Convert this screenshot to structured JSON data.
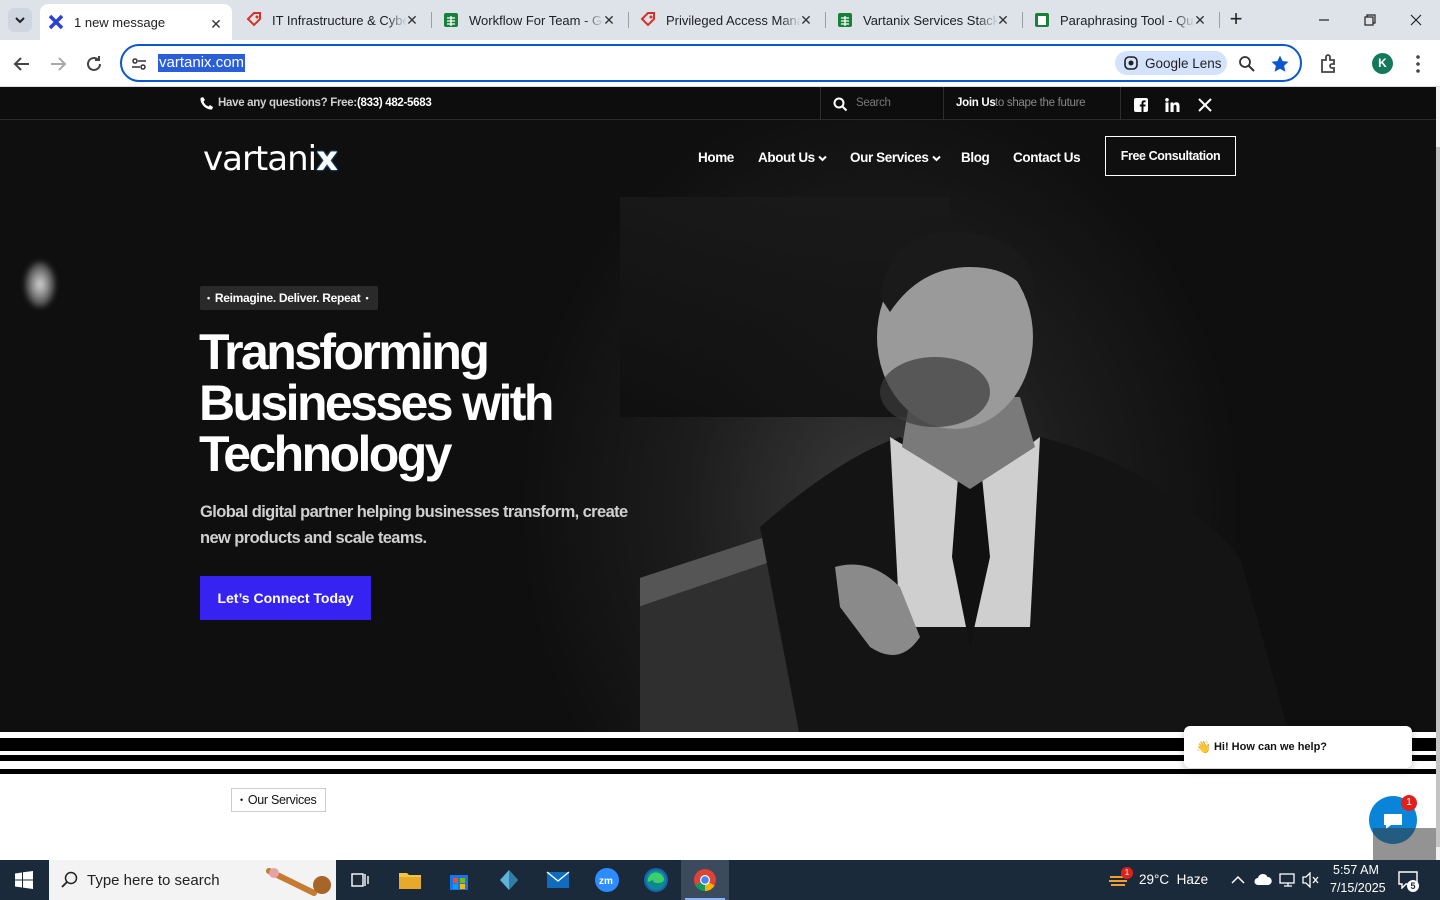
{
  "browser": {
    "tabs": [
      {
        "title": "1 new message",
        "active": true
      },
      {
        "title": "IT Infrastructure & Cybersecurity"
      },
      {
        "title": "Workflow For Team - Google Sheets"
      },
      {
        "title": "Privileged Access Management"
      },
      {
        "title": "Vartanix Services Stack"
      },
      {
        "title": "Paraphrasing Tool - QuillBot"
      }
    ],
    "url": "vartanix.com",
    "lens_label": "Google Lens",
    "profile_initial": "K"
  },
  "site": {
    "topbar": {
      "phone_prefix": "Have any questions? Free:",
      "phone": "(833) 482-5683",
      "search_placeholder": "Search",
      "join_bold": "Join Us",
      "join_rest": "to shape the future"
    },
    "logo_text": "vartani",
    "logo_x": "x",
    "nav": [
      "Home",
      "About Us",
      "Our Services",
      "Blog",
      "Contact Us"
    ],
    "cta_header": "Free Consultation",
    "hero": {
      "tagline": "Reimagine. Deliver. Repeat",
      "heading_l1": "Transforming",
      "heading_l2": "Businesses with",
      "heading_l3": "Technology",
      "subtext": "Global digital partner helping businesses transform, create new products and scale teams.",
      "button": "Let’s Connect Today"
    },
    "services_tag": "Our Services",
    "chat": {
      "greeting_emoji": "👋",
      "greeting": "Hi! How can we help?",
      "badge": "1"
    }
  },
  "taskbar": {
    "search_placeholder": "Type here to search",
    "weather": "29°C  Haze",
    "weather_badge": "1",
    "time": "5:57 AM",
    "date": "7/15/2025",
    "notif_count": "5"
  }
}
